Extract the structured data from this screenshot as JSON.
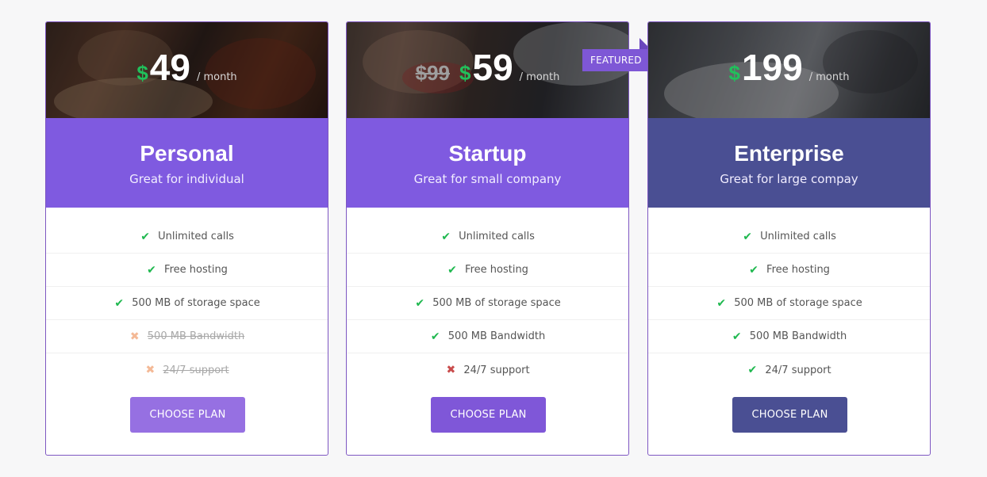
{
  "colors": {
    "primary_purple": "#7f5ae0",
    "enterprise_navy": "#4a4f93",
    "currency_green": "#21c05b",
    "check_green": "#1fb84f",
    "cross_red": "#c94c4c",
    "cross_soft": "#f4b996"
  },
  "plans": [
    {
      "name": "Personal",
      "tagline": "Great for individual",
      "old_price": "",
      "currency": "$",
      "price": "49",
      "period": "/ month",
      "featured_label": "",
      "button_label": "CHOOSE PLAN",
      "features": [
        {
          "text": "Unlimited calls",
          "included": true,
          "icon": "check-icon"
        },
        {
          "text": "Free hosting",
          "included": true,
          "icon": "check-icon"
        },
        {
          "text": "500 MB of storage space",
          "included": true,
          "icon": "check-icon"
        },
        {
          "text": "500 MB Bandwidth",
          "included": false,
          "icon": "cross-icon"
        },
        {
          "text": "24/7 support",
          "included": false,
          "icon": "cross-icon"
        }
      ]
    },
    {
      "name": "Startup",
      "tagline": "Great for small company",
      "old_price": "$99",
      "currency": "$",
      "price": "59",
      "period": "/ month",
      "featured_label": "FEATURED",
      "button_label": "CHOOSE PLAN",
      "features": [
        {
          "text": "Unlimited calls",
          "included": true,
          "icon": "check-icon"
        },
        {
          "text": "Free hosting",
          "included": true,
          "icon": "check-icon"
        },
        {
          "text": "500 MB of storage space",
          "included": true,
          "icon": "check-icon"
        },
        {
          "text": "500 MB Bandwidth",
          "included": true,
          "icon": "check-icon"
        },
        {
          "text": "24/7 support",
          "included": false,
          "icon": "cross-icon"
        }
      ]
    },
    {
      "name": "Enterprise",
      "tagline": "Great for large compay",
      "old_price": "",
      "currency": "$",
      "price": "199",
      "period": "/ month",
      "featured_label": "",
      "button_label": "CHOOSE PLAN",
      "features": [
        {
          "text": "Unlimited calls",
          "included": true,
          "icon": "check-icon"
        },
        {
          "text": "Free hosting",
          "included": true,
          "icon": "check-icon"
        },
        {
          "text": "500 MB of storage space",
          "included": true,
          "icon": "check-icon"
        },
        {
          "text": "500 MB Bandwidth",
          "included": true,
          "icon": "check-icon"
        },
        {
          "text": "24/7 support",
          "included": true,
          "icon": "check-icon"
        }
      ]
    }
  ]
}
